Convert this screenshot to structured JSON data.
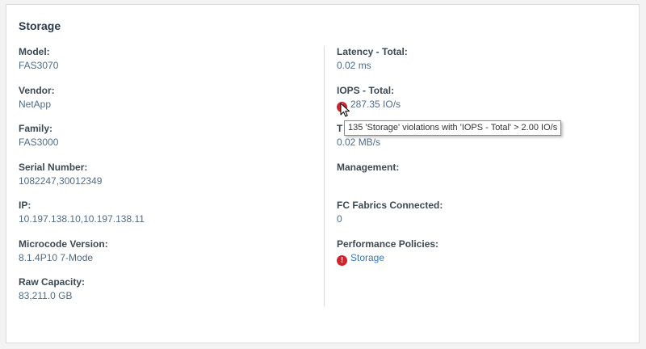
{
  "card": {
    "title": "Storage",
    "left_fields": [
      {
        "label": "Model:",
        "value": "FAS3070"
      },
      {
        "label": "Vendor:",
        "value": "NetApp"
      },
      {
        "label": "Family:",
        "value": "FAS3000"
      },
      {
        "label": "Serial Number:",
        "value": "1082247,30012349"
      },
      {
        "label": "IP:",
        "value": "10.197.138.10,10.197.138.11"
      },
      {
        "label": "Microcode Version:",
        "value": "8.1.4P10 7-Mode"
      },
      {
        "label": "Raw Capacity:",
        "value": "83,211.0 GB"
      }
    ],
    "right_fields": {
      "latency": {
        "label": "Latency - Total:",
        "value": "0.02 ms"
      },
      "iops": {
        "label": "IOPS - Total:",
        "value": "287.35 IO/s",
        "status": "violation"
      },
      "throughput": {
        "label": "T",
        "value": "0.02 MB/s"
      },
      "management": {
        "label": "Management:",
        "value": ""
      },
      "fc_fabrics": {
        "label": "FC Fabrics Connected:",
        "value": "0"
      },
      "policies": {
        "label": "Performance Policies:",
        "value": "Storage",
        "status": "violation"
      }
    }
  },
  "tooltip": {
    "text": "135 'Storage' violations with 'IOPS - Total' > 2.00 IO/s"
  },
  "colors": {
    "alert": "#d0232c",
    "link": "#2f79c1",
    "value_text": "#4f6b8a"
  }
}
